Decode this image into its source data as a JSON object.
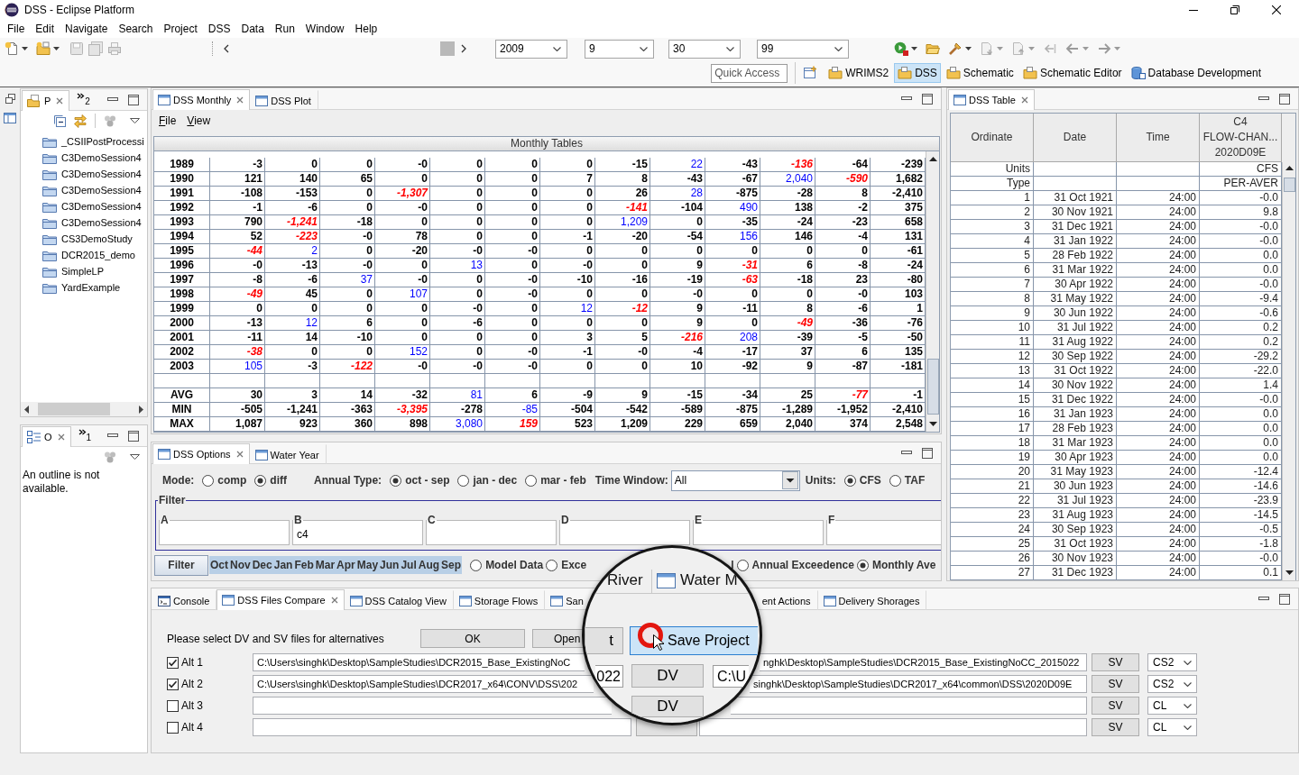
{
  "window": {
    "title": "DSS - Eclipse Platform"
  },
  "menu": [
    "File",
    "Edit",
    "Navigate",
    "Search",
    "Project",
    "DSS",
    "Data",
    "Run",
    "Window",
    "Help"
  ],
  "toolbar": {
    "selectors": [
      "2009",
      "9",
      "30",
      "99"
    ],
    "quick_access": {
      "placeholder": "Quick Access"
    },
    "perspectives": [
      {
        "label": "WRIMS2",
        "selected": false,
        "kind": "folder"
      },
      {
        "label": "DSS",
        "selected": true,
        "kind": "folder"
      },
      {
        "label": "Schematic",
        "selected": false,
        "kind": "folder"
      },
      {
        "label": "Schematic Editor",
        "selected": false,
        "kind": "folder"
      },
      {
        "label": "Database Development",
        "selected": false,
        "kind": "database"
      }
    ]
  },
  "project_view": {
    "tabs": [
      {
        "label": "P",
        "selected": true
      }
    ],
    "overflow_count": "2",
    "items": [
      "_CSIIPostProcessi",
      "C3DemoSession4",
      "C3DemoSession4",
      "C3DemoSession4",
      "C3DemoSession4",
      "C3DemoSession4",
      "CS3DemoStudy",
      "DCR2015_demo",
      "SimpleLP",
      "YardExample"
    ]
  },
  "outline_view": {
    "tabs": [
      {
        "label": "O",
        "selected": true
      }
    ],
    "overflow_count": "1",
    "message": "An outline is not available."
  },
  "monthly_view": {
    "tabs": [
      {
        "label": "DSS Monthly",
        "selected": true
      },
      {
        "label": "DSS Plot",
        "selected": false
      }
    ],
    "menu": [
      "File",
      "View"
    ],
    "table": {
      "title": "Monthly Tables",
      "rows": [
        {
          "kind": "data",
          "label": "1989",
          "cells": [
            {
              "value": "-3",
              "kind": "plain"
            },
            {
              "value": "0",
              "kind": "plain"
            },
            {
              "value": "0",
              "kind": "plain"
            },
            {
              "value": "-0",
              "kind": "plain"
            },
            {
              "value": "0",
              "kind": "plain"
            },
            {
              "value": "0",
              "kind": "plain"
            },
            {
              "value": "0",
              "kind": "plain"
            },
            {
              "value": "-15",
              "kind": "plain"
            },
            {
              "value": "22",
              "kind": "max"
            },
            {
              "value": "-43",
              "kind": "plain"
            },
            {
              "value": "-136",
              "kind": "min"
            },
            {
              "value": "-64",
              "kind": "plain"
            },
            {
              "value": "-239",
              "kind": "plain"
            }
          ]
        },
        {
          "kind": "data",
          "label": "1990",
          "cells": [
            {
              "value": "121",
              "kind": "plain"
            },
            {
              "value": "140",
              "kind": "plain"
            },
            {
              "value": "65",
              "kind": "plain"
            },
            {
              "value": "0",
              "kind": "plain"
            },
            {
              "value": "0",
              "kind": "plain"
            },
            {
              "value": "0",
              "kind": "plain"
            },
            {
              "value": "7",
              "kind": "plain"
            },
            {
              "value": "8",
              "kind": "plain"
            },
            {
              "value": "-43",
              "kind": "plain"
            },
            {
              "value": "-67",
              "kind": "plain"
            },
            {
              "value": "2,040",
              "kind": "max"
            },
            {
              "value": "-590",
              "kind": "min"
            },
            {
              "value": "1,682",
              "kind": "plain"
            }
          ]
        },
        {
          "kind": "data",
          "label": "1991",
          "cells": [
            {
              "value": "-108",
              "kind": "plain"
            },
            {
              "value": "-153",
              "kind": "plain"
            },
            {
              "value": "0",
              "kind": "plain"
            },
            {
              "value": "-1,307",
              "kind": "min"
            },
            {
              "value": "0",
              "kind": "plain"
            },
            {
              "value": "0",
              "kind": "plain"
            },
            {
              "value": "0",
              "kind": "plain"
            },
            {
              "value": "26",
              "kind": "plain"
            },
            {
              "value": "28",
              "kind": "max"
            },
            {
              "value": "-875",
              "kind": "plain"
            },
            {
              "value": "-28",
              "kind": "plain"
            },
            {
              "value": "8",
              "kind": "plain"
            },
            {
              "value": "-2,410",
              "kind": "plain"
            }
          ]
        },
        {
          "kind": "data",
          "label": "1992",
          "cells": [
            {
              "value": "-1",
              "kind": "plain"
            },
            {
              "value": "-6",
              "kind": "plain"
            },
            {
              "value": "0",
              "kind": "plain"
            },
            {
              "value": "-0",
              "kind": "plain"
            },
            {
              "value": "0",
              "kind": "plain"
            },
            {
              "value": "0",
              "kind": "plain"
            },
            {
              "value": "0",
              "kind": "plain"
            },
            {
              "value": "-141",
              "kind": "min"
            },
            {
              "value": "-104",
              "kind": "plain"
            },
            {
              "value": "490",
              "kind": "max"
            },
            {
              "value": "138",
              "kind": "plain"
            },
            {
              "value": "-2",
              "kind": "plain"
            },
            {
              "value": "375",
              "kind": "plain"
            }
          ]
        },
        {
          "kind": "data",
          "label": "1993",
          "cells": [
            {
              "value": "790",
              "kind": "plain"
            },
            {
              "value": "-1,241",
              "kind": "min"
            },
            {
              "value": "-18",
              "kind": "plain"
            },
            {
              "value": "0",
              "kind": "plain"
            },
            {
              "value": "0",
              "kind": "plain"
            },
            {
              "value": "0",
              "kind": "plain"
            },
            {
              "value": "0",
              "kind": "plain"
            },
            {
              "value": "1,209",
              "kind": "max"
            },
            {
              "value": "0",
              "kind": "plain"
            },
            {
              "value": "-35",
              "kind": "plain"
            },
            {
              "value": "-24",
              "kind": "plain"
            },
            {
              "value": "-23",
              "kind": "plain"
            },
            {
              "value": "658",
              "kind": "plain"
            }
          ]
        },
        {
          "kind": "data",
          "label": "1994",
          "cells": [
            {
              "value": "52",
              "kind": "plain"
            },
            {
              "value": "-223",
              "kind": "min"
            },
            {
              "value": "-0",
              "kind": "plain"
            },
            {
              "value": "78",
              "kind": "plain"
            },
            {
              "value": "0",
              "kind": "plain"
            },
            {
              "value": "0",
              "kind": "plain"
            },
            {
              "value": "-1",
              "kind": "plain"
            },
            {
              "value": "-20",
              "kind": "plain"
            },
            {
              "value": "-54",
              "kind": "plain"
            },
            {
              "value": "156",
              "kind": "max"
            },
            {
              "value": "146",
              "kind": "plain"
            },
            {
              "value": "-4",
              "kind": "plain"
            },
            {
              "value": "131",
              "kind": "plain"
            }
          ]
        },
        {
          "kind": "data",
          "label": "1995",
          "cells": [
            {
              "value": "-44",
              "kind": "min"
            },
            {
              "value": "2",
              "kind": "max"
            },
            {
              "value": "0",
              "kind": "plain"
            },
            {
              "value": "-20",
              "kind": "plain"
            },
            {
              "value": "-0",
              "kind": "plain"
            },
            {
              "value": "-0",
              "kind": "plain"
            },
            {
              "value": "0",
              "kind": "plain"
            },
            {
              "value": "0",
              "kind": "plain"
            },
            {
              "value": "0",
              "kind": "plain"
            },
            {
              "value": "0",
              "kind": "plain"
            },
            {
              "value": "0",
              "kind": "plain"
            },
            {
              "value": "0",
              "kind": "plain"
            },
            {
              "value": "-61",
              "kind": "plain"
            }
          ]
        },
        {
          "kind": "data",
          "label": "1996",
          "cells": [
            {
              "value": "-0",
              "kind": "plain"
            },
            {
              "value": "-13",
              "kind": "plain"
            },
            {
              "value": "-0",
              "kind": "plain"
            },
            {
              "value": "0",
              "kind": "plain"
            },
            {
              "value": "13",
              "kind": "max"
            },
            {
              "value": "0",
              "kind": "plain"
            },
            {
              "value": "-0",
              "kind": "plain"
            },
            {
              "value": "0",
              "kind": "plain"
            },
            {
              "value": "9",
              "kind": "plain"
            },
            {
              "value": "-31",
              "kind": "min"
            },
            {
              "value": "6",
              "kind": "plain"
            },
            {
              "value": "-8",
              "kind": "plain"
            },
            {
              "value": "-24",
              "kind": "plain"
            }
          ]
        },
        {
          "kind": "data",
          "label": "1997",
          "cells": [
            {
              "value": "-8",
              "kind": "plain"
            },
            {
              "value": "-6",
              "kind": "plain"
            },
            {
              "value": "37",
              "kind": "max"
            },
            {
              "value": "-0",
              "kind": "plain"
            },
            {
              "value": "0",
              "kind": "plain"
            },
            {
              "value": "-0",
              "kind": "plain"
            },
            {
              "value": "-10",
              "kind": "plain"
            },
            {
              "value": "-16",
              "kind": "plain"
            },
            {
              "value": "-19",
              "kind": "plain"
            },
            {
              "value": "-63",
              "kind": "min"
            },
            {
              "value": "-18",
              "kind": "plain"
            },
            {
              "value": "23",
              "kind": "plain"
            },
            {
              "value": "-80",
              "kind": "plain"
            }
          ]
        },
        {
          "kind": "data",
          "label": "1998",
          "cells": [
            {
              "value": "-49",
              "kind": "min"
            },
            {
              "value": "45",
              "kind": "plain"
            },
            {
              "value": "0",
              "kind": "plain"
            },
            {
              "value": "107",
              "kind": "max"
            },
            {
              "value": "0",
              "kind": "plain"
            },
            {
              "value": "-0",
              "kind": "plain"
            },
            {
              "value": "0",
              "kind": "plain"
            },
            {
              "value": "0",
              "kind": "plain"
            },
            {
              "value": "-0",
              "kind": "plain"
            },
            {
              "value": "0",
              "kind": "plain"
            },
            {
              "value": "0",
              "kind": "plain"
            },
            {
              "value": "-0",
              "kind": "plain"
            },
            {
              "value": "103",
              "kind": "plain"
            }
          ]
        },
        {
          "kind": "data",
          "label": "1999",
          "cells": [
            {
              "value": "0",
              "kind": "plain"
            },
            {
              "value": "0",
              "kind": "plain"
            },
            {
              "value": "0",
              "kind": "plain"
            },
            {
              "value": "0",
              "kind": "plain"
            },
            {
              "value": "-0",
              "kind": "plain"
            },
            {
              "value": "0",
              "kind": "plain"
            },
            {
              "value": "12",
              "kind": "max"
            },
            {
              "value": "-12",
              "kind": "min"
            },
            {
              "value": "9",
              "kind": "plain"
            },
            {
              "value": "-11",
              "kind": "plain"
            },
            {
              "value": "8",
              "kind": "plain"
            },
            {
              "value": "-6",
              "kind": "plain"
            },
            {
              "value": "1",
              "kind": "plain"
            }
          ]
        },
        {
          "kind": "data",
          "label": "2000",
          "cells": [
            {
              "value": "-13",
              "kind": "plain"
            },
            {
              "value": "12",
              "kind": "max"
            },
            {
              "value": "6",
              "kind": "plain"
            },
            {
              "value": "0",
              "kind": "plain"
            },
            {
              "value": "-6",
              "kind": "plain"
            },
            {
              "value": "0",
              "kind": "plain"
            },
            {
              "value": "0",
              "kind": "plain"
            },
            {
              "value": "0",
              "kind": "plain"
            },
            {
              "value": "9",
              "kind": "plain"
            },
            {
              "value": "0",
              "kind": "plain"
            },
            {
              "value": "-49",
              "kind": "min"
            },
            {
              "value": "-36",
              "kind": "plain"
            },
            {
              "value": "-76",
              "kind": "plain"
            }
          ]
        },
        {
          "kind": "data",
          "label": "2001",
          "cells": [
            {
              "value": "-11",
              "kind": "plain"
            },
            {
              "value": "14",
              "kind": "plain"
            },
            {
              "value": "-10",
              "kind": "plain"
            },
            {
              "value": "0",
              "kind": "plain"
            },
            {
              "value": "0",
              "kind": "plain"
            },
            {
              "value": "0",
              "kind": "plain"
            },
            {
              "value": "3",
              "kind": "plain"
            },
            {
              "value": "5",
              "kind": "plain"
            },
            {
              "value": "-216",
              "kind": "min"
            },
            {
              "value": "208",
              "kind": "max"
            },
            {
              "value": "-39",
              "kind": "plain"
            },
            {
              "value": "-5",
              "kind": "plain"
            },
            {
              "value": "-50",
              "kind": "plain"
            }
          ]
        },
        {
          "kind": "data",
          "label": "2002",
          "cells": [
            {
              "value": "-38",
              "kind": "min"
            },
            {
              "value": "0",
              "kind": "plain"
            },
            {
              "value": "0",
              "kind": "plain"
            },
            {
              "value": "152",
              "kind": "max"
            },
            {
              "value": "0",
              "kind": "plain"
            },
            {
              "value": "-0",
              "kind": "plain"
            },
            {
              "value": "-1",
              "kind": "plain"
            },
            {
              "value": "-0",
              "kind": "plain"
            },
            {
              "value": "-4",
              "kind": "plain"
            },
            {
              "value": "-17",
              "kind": "plain"
            },
            {
              "value": "37",
              "kind": "plain"
            },
            {
              "value": "6",
              "kind": "plain"
            },
            {
              "value": "135",
              "kind": "plain"
            }
          ]
        },
        {
          "kind": "data",
          "label": "2003",
          "cells": [
            {
              "value": "105",
              "kind": "max"
            },
            {
              "value": "-3",
              "kind": "plain"
            },
            {
              "value": "-122",
              "kind": "min"
            },
            {
              "value": "-0",
              "kind": "plain"
            },
            {
              "value": "-0",
              "kind": "plain"
            },
            {
              "value": "-0",
              "kind": "plain"
            },
            {
              "value": "0",
              "kind": "plain"
            },
            {
              "value": "0",
              "kind": "plain"
            },
            {
              "value": "10",
              "kind": "plain"
            },
            {
              "value": "-92",
              "kind": "plain"
            },
            {
              "value": "9",
              "kind": "plain"
            },
            {
              "value": "-87",
              "kind": "plain"
            },
            {
              "value": "-181",
              "kind": "plain"
            }
          ]
        },
        {
          "kind": "blank"
        },
        {
          "kind": "data",
          "label": "AVG",
          "cells": [
            {
              "value": "30",
              "kind": "plain"
            },
            {
              "value": "3",
              "kind": "plain"
            },
            {
              "value": "14",
              "kind": "plain"
            },
            {
              "value": "-32",
              "kind": "plain"
            },
            {
              "value": "81",
              "kind": "max"
            },
            {
              "value": "6",
              "kind": "plain"
            },
            {
              "value": "-9",
              "kind": "plain"
            },
            {
              "value": "9",
              "kind": "plain"
            },
            {
              "value": "-15",
              "kind": "plain"
            },
            {
              "value": "-34",
              "kind": "plain"
            },
            {
              "value": "25",
              "kind": "plain"
            },
            {
              "value": "-77",
              "kind": "min"
            },
            {
              "value": "-1",
              "kind": "plain"
            }
          ]
        },
        {
          "kind": "data",
          "label": "MIN",
          "cells": [
            {
              "value": "-505",
              "kind": "plain"
            },
            {
              "value": "-1,241",
              "kind": "plain"
            },
            {
              "value": "-363",
              "kind": "plain"
            },
            {
              "value": "-3,395",
              "kind": "min"
            },
            {
              "value": "-278",
              "kind": "plain"
            },
            {
              "value": "-85",
              "kind": "max"
            },
            {
              "value": "-504",
              "kind": "plain"
            },
            {
              "value": "-542",
              "kind": "plain"
            },
            {
              "value": "-589",
              "kind": "plain"
            },
            {
              "value": "-875",
              "kind": "plain"
            },
            {
              "value": "-1,289",
              "kind": "plain"
            },
            {
              "value": "-1,952",
              "kind": "plain"
            },
            {
              "value": "-2,410",
              "kind": "plain"
            }
          ]
        },
        {
          "kind": "data",
          "label": "MAX",
          "cells": [
            {
              "value": "1,087",
              "kind": "plain"
            },
            {
              "value": "923",
              "kind": "plain"
            },
            {
              "value": "360",
              "kind": "plain"
            },
            {
              "value": "898",
              "kind": "plain"
            },
            {
              "value": "3,080",
              "kind": "max"
            },
            {
              "value": "159",
              "kind": "min"
            },
            {
              "value": "523",
              "kind": "plain"
            },
            {
              "value": "1,209",
              "kind": "plain"
            },
            {
              "value": "229",
              "kind": "plain"
            },
            {
              "value": "659",
              "kind": "plain"
            },
            {
              "value": "2,040",
              "kind": "plain"
            },
            {
              "value": "374",
              "kind": "plain"
            },
            {
              "value": "2,548",
              "kind": "plain"
            }
          ]
        }
      ]
    }
  },
  "options_view": {
    "tabs": [
      {
        "label": "DSS Options",
        "selected": true
      },
      {
        "label": "Water Year",
        "selected": false
      }
    ],
    "mode": {
      "label": "Mode:",
      "options": [
        {
          "label": "comp",
          "selected": false
        },
        {
          "label": "diff",
          "selected": true
        }
      ]
    },
    "annual_type": {
      "label": "Annual Type:",
      "options": [
        {
          "label": "oct - sep",
          "selected": true
        },
        {
          "label": "jan - dec",
          "selected": false
        },
        {
          "label": "mar - feb",
          "selected": false
        }
      ]
    },
    "time_window": {
      "label": "Time Window:",
      "value": "All"
    },
    "units": {
      "label": "Units:",
      "options": [
        {
          "label": "CFS",
          "selected": true
        },
        {
          "label": "TAF",
          "selected": false
        }
      ]
    },
    "filter": {
      "title": "Filter",
      "fields": [
        {
          "label": "A"
        },
        {
          "label": "B",
          "value": "c4"
        },
        {
          "label": "C"
        },
        {
          "label": "D"
        },
        {
          "label": "E"
        },
        {
          "label": "F"
        }
      ]
    },
    "filter_button": "Filter",
    "months": [
      {
        "label": "Oct",
        "selected": true
      },
      {
        "label": "Nov",
        "selected": true
      },
      {
        "label": "Dec",
        "selected": true
      },
      {
        "label": "Jan",
        "selected": true
      },
      {
        "label": "Feb",
        "selected": true
      },
      {
        "label": "Mar",
        "selected": true
      },
      {
        "label": "Apr",
        "selected": true
      },
      {
        "label": "May",
        "selected": true
      },
      {
        "label": "Jun",
        "selected": true
      },
      {
        "label": "Jul",
        "selected": true
      },
      {
        "label": "Aug",
        "selected": true
      },
      {
        "label": "Sep",
        "selected": true
      }
    ],
    "views": [
      {
        "label": "Model Data",
        "selected": false
      },
      {
        "label": "Exce",
        "selected": false
      }
    ],
    "cut_label": "l",
    "views_right": [
      {
        "label": "Annual Exceedence",
        "selected": false
      },
      {
        "label": "Monthly Ave",
        "selected": true
      }
    ]
  },
  "table_view": {
    "tabs": [
      {
        "label": "DSS Table",
        "selected": true
      }
    ],
    "columns": [
      {
        "lines": [
          "Ordinate"
        ]
      },
      {
        "lines": [
          "Date"
        ]
      },
      {
        "lines": [
          "Time"
        ]
      },
      {
        "lines": [
          "C4",
          "FLOW-CHAN...",
          "2020D09E"
        ]
      }
    ],
    "meta_rows": [
      {
        "label": "Units",
        "value": "CFS"
      },
      {
        "label": "Type",
        "value": "PER-AVER"
      }
    ],
    "rows": [
      [
        "1",
        "31 Oct 1921",
        "24:00",
        "-0.0"
      ],
      [
        "2",
        "30 Nov 1921",
        "24:00",
        "9.8"
      ],
      [
        "3",
        "31 Dec 1921",
        "24:00",
        "-0.0"
      ],
      [
        "4",
        "31 Jan 1922",
        "24:00",
        "-0.0"
      ],
      [
        "5",
        "28 Feb 1922",
        "24:00",
        "0.0"
      ],
      [
        "6",
        "31 Mar 1922",
        "24:00",
        "0.0"
      ],
      [
        "7",
        "30 Apr 1922",
        "24:00",
        "-0.0"
      ],
      [
        "8",
        "31 May 1922",
        "24:00",
        "-9.4"
      ],
      [
        "9",
        "30 Jun 1922",
        "24:00",
        "-0.6"
      ],
      [
        "10",
        "31 Jul 1922",
        "24:00",
        "0.2"
      ],
      [
        "11",
        "31 Aug 1922",
        "24:00",
        "0.2"
      ],
      [
        "12",
        "30 Sep 1922",
        "24:00",
        "-29.2"
      ],
      [
        "13",
        "31 Oct 1922",
        "24:00",
        "-22.0"
      ],
      [
        "14",
        "30 Nov 1922",
        "24:00",
        "1.4"
      ],
      [
        "15",
        "31 Dec 1922",
        "24:00",
        "-0.0"
      ],
      [
        "16",
        "31 Jan 1923",
        "24:00",
        "0.0"
      ],
      [
        "17",
        "28 Feb 1923",
        "24:00",
        "0.0"
      ],
      [
        "18",
        "31 Mar 1923",
        "24:00",
        "0.0"
      ],
      [
        "19",
        "30 Apr 1923",
        "24:00",
        "0.0"
      ],
      [
        "20",
        "31 May 1923",
        "24:00",
        "-12.4"
      ],
      [
        "21",
        "30 Jun 1923",
        "24:00",
        "-14.6"
      ],
      [
        "22",
        "31 Jul 1923",
        "24:00",
        "-23.9"
      ],
      [
        "23",
        "31 Aug 1923",
        "24:00",
        "-14.5"
      ],
      [
        "24",
        "30 Sep 1923",
        "24:00",
        "-0.5"
      ],
      [
        "25",
        "31 Oct 1923",
        "24:00",
        "-1.8"
      ],
      [
        "26",
        "30 Nov 1923",
        "24:00",
        "-0.0"
      ],
      [
        "27",
        "31 Dec 1923",
        "24:00",
        "0.1"
      ]
    ]
  },
  "compare_view": {
    "tabs": [
      {
        "label": "Console",
        "selected": false,
        "kind": "console"
      },
      {
        "label": "DSS Files Compare",
        "selected": true,
        "kind": "view"
      },
      {
        "label": "DSS Catalog View",
        "selected": false,
        "kind": "view"
      },
      {
        "label": "Storage Flows",
        "selected": false,
        "kind": "view"
      },
      {
        "label": "San",
        "selected": false,
        "kind": "cut"
      },
      {
        "label": "ent Actions",
        "selected": false,
        "kind": "clipped"
      },
      {
        "label": "Delivery Shorages",
        "selected": false,
        "kind": "view"
      }
    ],
    "prompt": "Please select DV and SV files for alternatives",
    "buttons": [
      "OK",
      "Open"
    ],
    "alternatives": [
      {
        "label": "Alt 1",
        "checked": true,
        "dv_path": "C:\\Users\\singhk\\Desktop\\SampleStudies\\DCR2015_Base_ExistingNoC",
        "dv_button": false,
        "sv_path": "nghk\\Desktop\\SampleStudies\\DCR2015_Base_ExistingNoCC_2015022",
        "sv_button": "SV",
        "study": "CS2"
      },
      {
        "label": "Alt 2",
        "checked": true,
        "dv_path": "C:\\Users\\singhk\\Desktop\\SampleStudies\\DCR2017_x64\\CONV\\DSS\\202",
        "dv_button": false,
        "sv_path": "singhk\\Desktop\\SampleStudies\\DCR2017_x64\\common\\DSS\\2020D09E",
        "sv_button": "SV",
        "study": "CS2"
      },
      {
        "label": "Alt 3",
        "checked": false,
        "dv_button": false,
        "sv_button": "SV",
        "study": "CL"
      },
      {
        "label": "Alt 4",
        "checked": false,
        "dv_button": true,
        "sv_button": "SV",
        "study": "CL"
      }
    ]
  },
  "magnifier": {
    "tabs": [
      {
        "label": "River",
        "selected": false
      },
      {
        "label": "Water M",
        "selected": false
      }
    ],
    "button_tail": "t",
    "button": "Save Project",
    "rows": [
      {
        "field_tail": "022",
        "button": "DV",
        "field_head": "C:\\U"
      },
      {
        "button": "DV"
      }
    ]
  }
}
